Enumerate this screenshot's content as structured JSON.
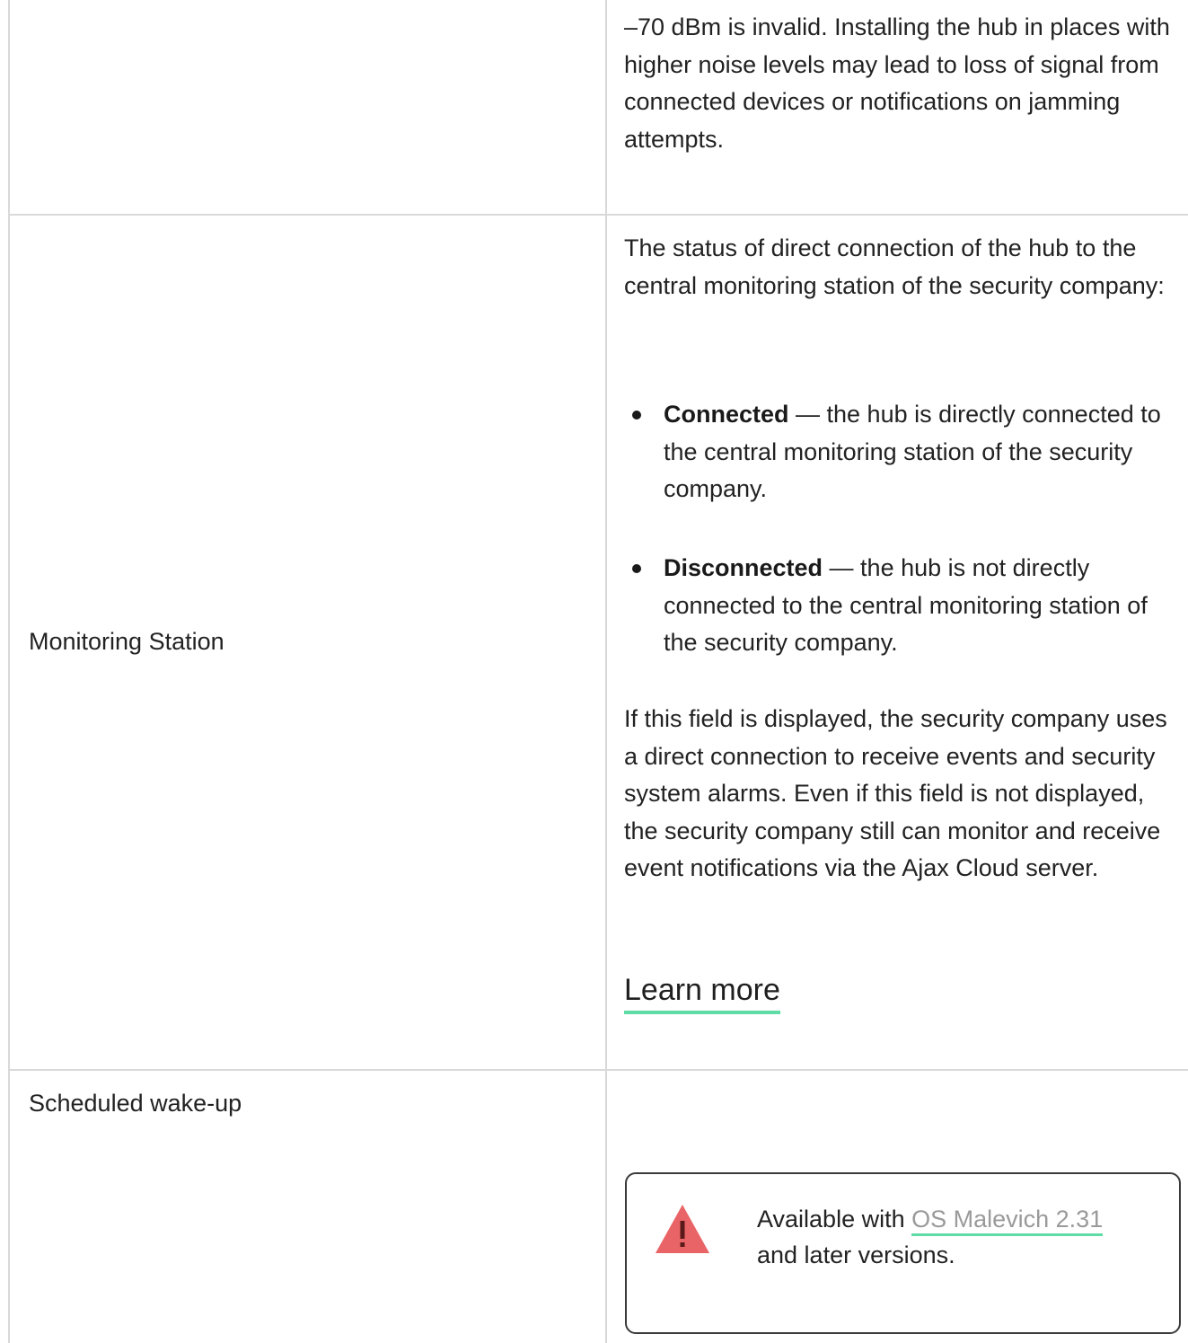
{
  "rows": [
    {
      "label": "",
      "paragraphs": [
        "–70 dBm is invalid. Installing the hub in places with higher noise levels may lead to loss of signal from connected devices or notifications on jamming attempts."
      ]
    },
    {
      "label": "Monitoring Station",
      "intro": "The status of direct connection of the hub to the central monitoring station of the security company:",
      "bullets": [
        {
          "term": "Connected",
          "text": " — the hub is directly connected to the central monitoring station of the security company."
        },
        {
          "term": "Disconnected",
          "text": " — the hub is not directly connected to the central monitoring station of the security company."
        }
      ],
      "outro": "If this field is displayed, the security company uses a direct connection to receive events and security system alarms. Even if this field is not displayed, the security company still can monitor and receive event notifications via the Ajax Cloud server.",
      "link_label": "Learn more"
    },
    {
      "label": "Scheduled wake-up",
      "note": {
        "prefix": "Available with ",
        "link": "OS Malevich 2.31",
        "suffix": " and later versions.",
        "icon": "warning-icon"
      }
    }
  ],
  "colors": {
    "accent_underline": "#5fdca5",
    "warning_icon": "#e96466",
    "border": "#d9d9d9"
  }
}
